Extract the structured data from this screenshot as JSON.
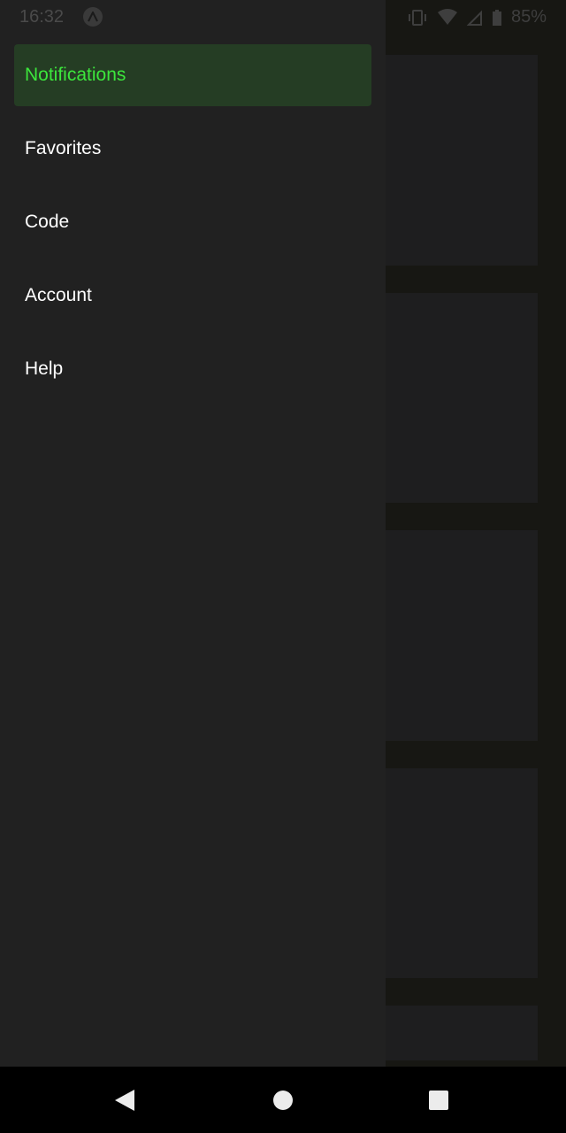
{
  "status_bar": {
    "time": "16:32",
    "battery": "85%"
  },
  "drawer": {
    "items": [
      {
        "label": "Notifications",
        "active": true
      },
      {
        "label": "Favorites",
        "active": false
      },
      {
        "label": "Code",
        "active": false
      },
      {
        "label": "Account",
        "active": false
      },
      {
        "label": "Help",
        "active": false
      }
    ]
  },
  "colors": {
    "drawer_bg": "#212121",
    "active_bg": "#253d24",
    "active_text": "#3ce63c",
    "text": "#ffffff"
  },
  "nav_bar": {
    "icons": [
      "back-icon",
      "home-icon",
      "recents-icon"
    ]
  }
}
